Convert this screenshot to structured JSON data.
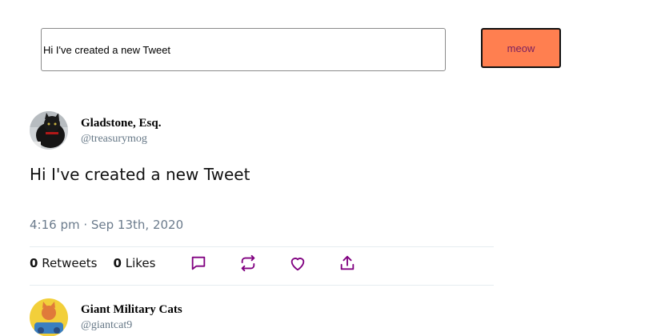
{
  "composer": {
    "input_value": "Hi I've created a new Tweet",
    "submit_label": "meow"
  },
  "tweets": [
    {
      "display_name": "Gladstone, Esq.",
      "handle": "@treasurymog",
      "text": "Hi I've created a new Tweet",
      "timestamp": "4:16 pm · Sep 13th, 2020",
      "retweets_count": "0",
      "retweets_label": "Retweets",
      "likes_count": "0",
      "likes_label": "Likes",
      "actions": [
        "reply-icon",
        "retweet-icon",
        "like-icon",
        "share-icon"
      ]
    },
    {
      "display_name": "Giant Military Cats",
      "handle": "@giantcat9"
    }
  ],
  "colors": {
    "button_bg": "#ff7f50",
    "button_text": "#7a1f5f",
    "icon": "#800080",
    "muted": "#657786"
  }
}
